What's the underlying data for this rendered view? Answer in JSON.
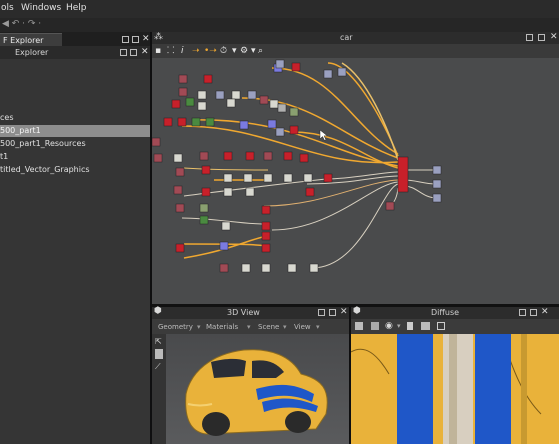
{
  "menubar": {
    "items": [
      "ols",
      "Windows",
      "Help"
    ]
  },
  "subbar": {
    "glyphs": "◀ ↶ · ↷ ·"
  },
  "left_panel": {
    "tab_label": "F  Explorer",
    "panel_title": "Explorer",
    "tree": [
      "ces",
      "500_part1",
      "500_part1_Resources",
      "t1",
      "titled_Vector_Graphics"
    ],
    "selected_index": 1
  },
  "graph": {
    "title": "car"
  },
  "view3d": {
    "title": "3D View",
    "menus": [
      "Geometry",
      "Materials",
      "Scene",
      "View"
    ]
  },
  "diffuse": {
    "title": "Diffuse"
  },
  "colors": {
    "accent_wire": "#f0a830",
    "node_red": "#c8202a",
    "car_yellow": "#e9b23a",
    "stripe_blue": "#1f57c8"
  }
}
